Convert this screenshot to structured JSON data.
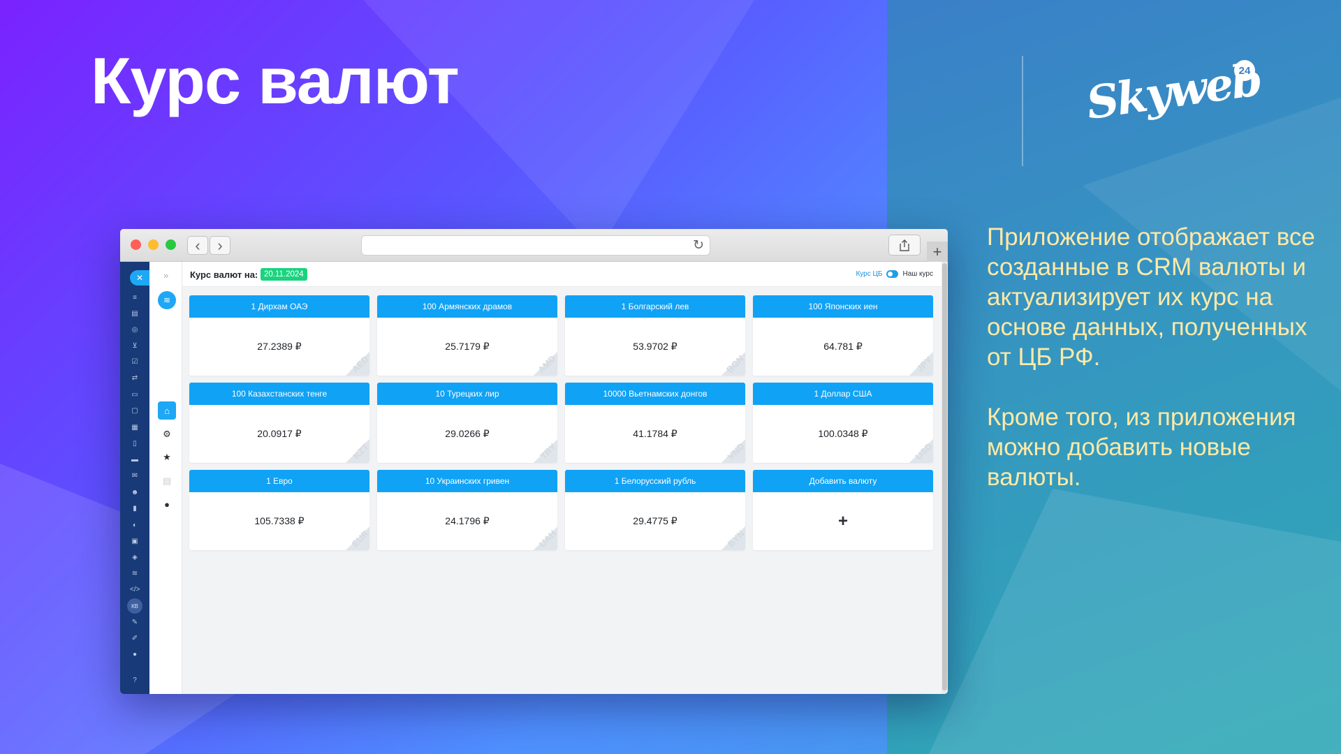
{
  "slide": {
    "title": "Курс валют",
    "description": [
      "Приложение отображает все созданные в CRM валюты и актуализирует их курс на основе данных, полученных от ЦБ РФ.",
      "Кроме того, из приложения можно добавить новые валюты."
    ],
    "logo_text": "Skyweb",
    "logo_badge": "24"
  },
  "browser": {
    "back_icon": "chevron-left",
    "forward_icon": "chevron-right",
    "url": "",
    "reload_icon": "reload",
    "share_icon": "share",
    "new_tab_icon": "plus"
  },
  "sidebar": {
    "close_icon": "close",
    "user_initials": "КВ",
    "help_icon": "question"
  },
  "app_sidebar": {
    "expand_icon": "double-chevron-right",
    "app_icon": "skyweb-logo",
    "items": [
      "home",
      "gear",
      "star",
      "document",
      "lightbulb"
    ]
  },
  "header": {
    "label": "Курс валют на:",
    "date": "20.11.2024",
    "switch_left": "Курс ЦБ",
    "switch_right": "Наш курс"
  },
  "currencies": [
    {
      "name": "1 Дирхам ОАЭ",
      "value": "27.2389 ₽",
      "code": "AED"
    },
    {
      "name": "100 Армянских драмов",
      "value": "25.7179 ₽",
      "code": "AMD"
    },
    {
      "name": "1 Болгарский лев",
      "value": "53.9702 ₽",
      "code": "BGN"
    },
    {
      "name": "100 Японских иен",
      "value": "64.781 ₽",
      "code": "JPY"
    },
    {
      "name": "100 Казахстанских тенге",
      "value": "20.0917 ₽",
      "code": "KZT"
    },
    {
      "name": "10 Турецких лир",
      "value": "29.0266 ₽",
      "code": "TRY"
    },
    {
      "name": "10000 Вьетнамских донгов",
      "value": "41.1784 ₽",
      "code": "VND"
    },
    {
      "name": "1 Доллар США",
      "value": "100.0348 ₽",
      "code": "USD"
    },
    {
      "name": "1 Евро",
      "value": "105.7338 ₽",
      "code": "EUR"
    },
    {
      "name": "10 Украинских гривен",
      "value": "24.1796 ₽",
      "code": "UAH"
    },
    {
      "name": "1 Белорусский рубль",
      "value": "29.4775 ₽",
      "code": "BYN"
    }
  ],
  "add_card": {
    "label": "Добавить валюту",
    "icon": "+"
  }
}
